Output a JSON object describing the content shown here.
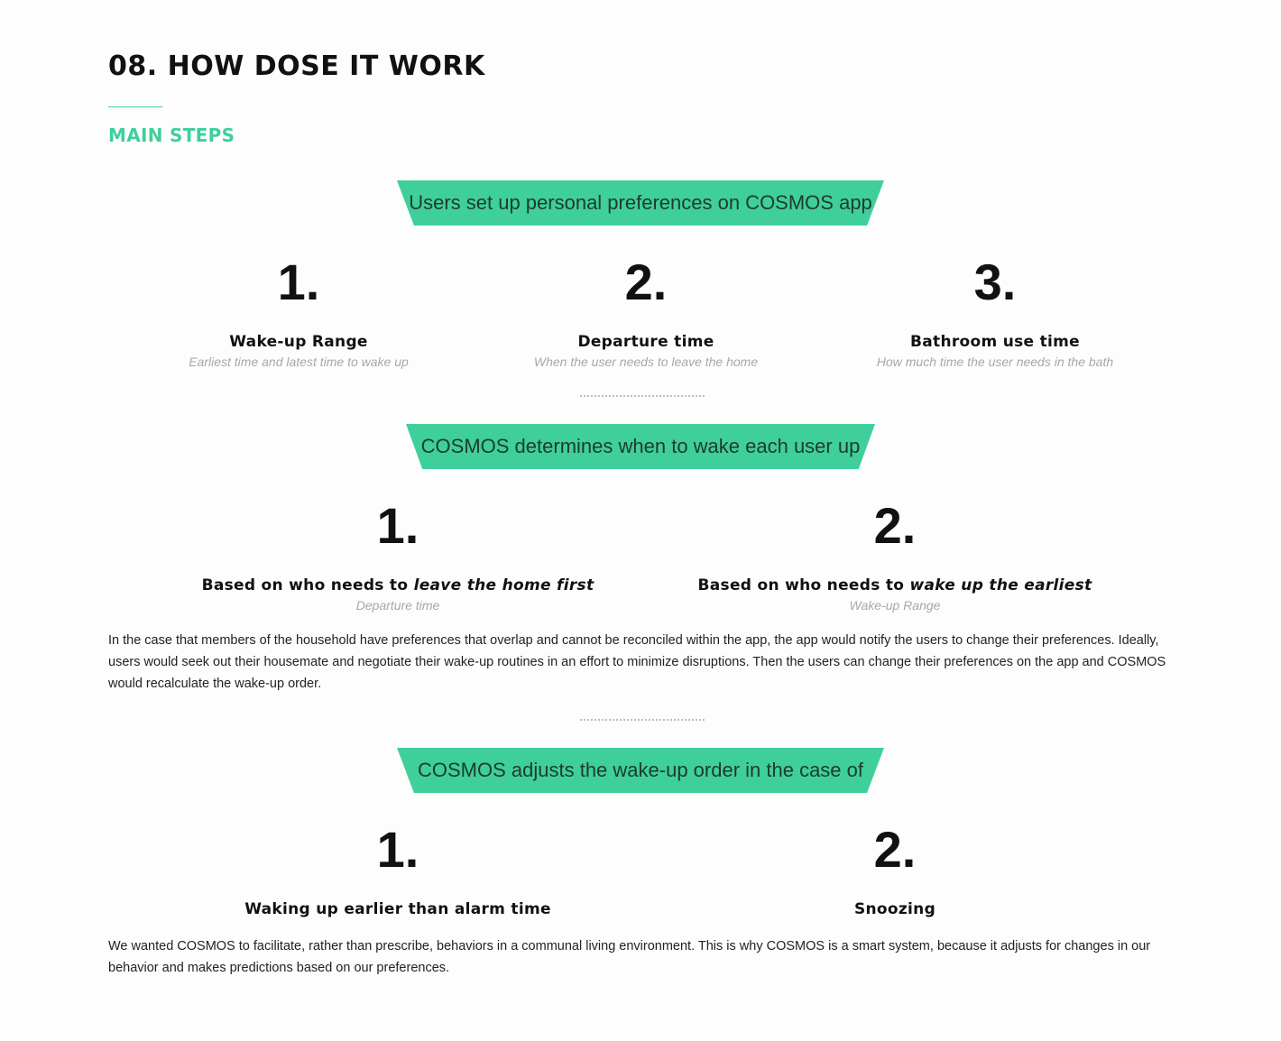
{
  "header": {
    "title": "08. HOW DOSE IT WORK",
    "section_label": "MAIN STEPS"
  },
  "sections": [
    {
      "banner": "Users set up personal preferences on COSMOS app",
      "steps": [
        {
          "number": "1.",
          "title": "Wake-up Range",
          "subtitle": "Earliest time and latest time to wake up"
        },
        {
          "number": "2.",
          "title": "Departure time",
          "subtitle": "When the user needs to leave the home"
        },
        {
          "number": "3.",
          "title": "Bathroom use time",
          "subtitle": "How much time the user needs in the bath"
        }
      ]
    },
    {
      "banner": "COSMOS determines when to wake each user up",
      "steps": [
        {
          "number": "1.",
          "title_prefix": "Based on who needs to ",
          "title_emphasis": "leave the home first",
          "subtitle": "Departure time"
        },
        {
          "number": "2.",
          "title_prefix": "Based on who needs to ",
          "title_emphasis": "wake up the earliest",
          "subtitle": "Wake-up Range"
        }
      ],
      "paragraph": "In the case that members of the household have preferences that overlap and cannot be reconciled within the app, the app would notify the users to change their preferences. Ideally, users would seek out their housemate and negotiate their wake-up routines in an effort to minimize disruptions. Then the users can change their preferences on the app and COSMOS would recalculate the wake-up order."
    },
    {
      "banner": "COSMOS adjusts the wake-up order in the case of",
      "steps": [
        {
          "number": "1.",
          "title": "Waking up earlier than alarm time"
        },
        {
          "number": "2.",
          "title": "Snoozing"
        }
      ],
      "paragraph": "We wanted COSMOS to facilitate, rather than prescribe, behaviors in a communal living environment. This is why COSMOS is a smart system, because it adjusts for changes in our behavior and makes predictions based on our preferences."
    }
  ],
  "colors": {
    "accent": "#3fcf9b",
    "banner_text": "#1d3a33",
    "subtitle": "#a8a8a8"
  }
}
